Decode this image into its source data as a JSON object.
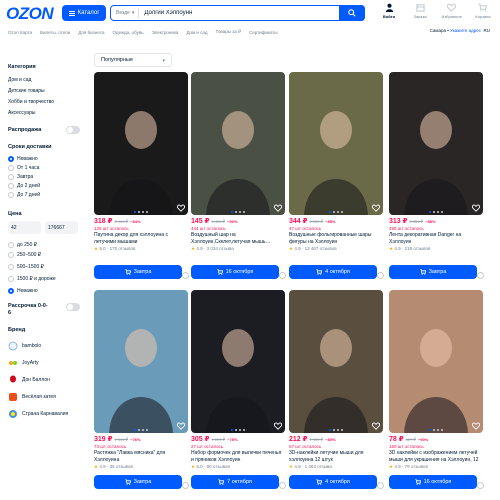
{
  "header": {
    "logo": "OZON",
    "catalog_label": "Каталог",
    "search_scope": "Везде",
    "search_query": "Долгий Хэппоунн",
    "icons": [
      {
        "name": "profile",
        "label": "Войти"
      },
      {
        "name": "orders",
        "label": "Заказы"
      },
      {
        "name": "favorites",
        "label": "Избранное"
      },
      {
        "name": "cart",
        "label": "Корзина"
      }
    ]
  },
  "subheader": {
    "links": [
      "Ozon Карта",
      "Билеты, отели",
      "Для бизнеса",
      "Одежда, обувь",
      "Электроника",
      "Дом и сад",
      "Товары за ₽",
      "Сертификаты"
    ],
    "location": "Самара",
    "address_link": "Укажите адрес",
    "lang": "RU"
  },
  "sort": {
    "label": "Популярные"
  },
  "sidebar": {
    "category_title": "Категория",
    "categories": [
      "Дом и сад",
      "Детские товары",
      "Хобби и творчество",
      "Аксессуары"
    ],
    "sale_label": "Распродажа",
    "delivery_title": "Сроки доставки",
    "delivery_options": [
      "Неважно",
      "От 1 часа",
      "Завтра",
      "До 2 дней",
      "До 7 дней"
    ],
    "price_title": "Цена",
    "price_from": "42",
    "price_to": "176667",
    "price_options": [
      "до 250 ₽",
      "250–500 ₽",
      "500–1500 ₽",
      "1500 ₽ и дороже",
      "Неважно"
    ],
    "installment_label": "Рассрочка 0-0-6",
    "brand_title": "Бренд",
    "brands": [
      "bambolo",
      "JoyArty",
      "Дон Баллон",
      "Весёлая затея",
      "Страна Карнавалия"
    ]
  },
  "products": [
    {
      "price": "318 ₽",
      "old_price": "2 009 ₽",
      "discount": "−84%",
      "left": "129 шт осталось",
      "title": "Паутина декор для хэллоуина с летучими мышами",
      "rating": "5.0",
      "reviews": "170 отзывов",
      "button": "Завтра"
    },
    {
      "price": "145 ₽",
      "old_price": "1 405 ₽",
      "discount": "−90%",
      "left": "444 шт осталось",
      "title": "Воздушный шар на Хэллоуин,Скелет,летучая мышь…",
      "rating": "4.9",
      "reviews": "3 034 отзыва",
      "button": "16 октября"
    },
    {
      "price": "344 ₽",
      "old_price": "2 250 ₽",
      "discount": "−85%",
      "left": "47 шт осталось",
      "title": "Воздушные фольгированные шары фигуры на Хэллоуин",
      "rating": "4.9",
      "reviews": "13 467 отзывов",
      "button": "4 октября"
    },
    {
      "price": "313 ₽",
      "old_price": "2 051 ₽",
      "discount": "−85%",
      "left": "495 шт осталось",
      "title": "Лента декоративная Danger на Хэллоуин",
      "rating": "4.9",
      "reviews": "216 отзывов",
      "button": "Завтра"
    },
    {
      "price": "319 ₽",
      "old_price": "1 341 ₽",
      "discount": "−76%",
      "left": "73 шт осталось",
      "title": "Растяжка \"Лавка мясника\" для Хэллоуина",
      "rating": "4.9",
      "reviews": "35 отзывов",
      "button": "Завтра"
    },
    {
      "price": "305 ₽",
      "old_price": "1 229 ₽",
      "discount": "−75%",
      "left": "27 шт осталось",
      "title": "Набор формочек для выпечки печенья и пряников Хэллоуин",
      "rating": "5.0",
      "reviews": "80 отзывов",
      "button": "7 октября"
    },
    {
      "price": "212 ₽",
      "old_price": "1 059 ₽",
      "discount": "−80%",
      "left": "57 шт осталось",
      "title": "3D-наклейки летучие мыши для хэллоуина 12 штук",
      "rating": "4.9",
      "reviews": "1 463 отзыва",
      "button": "4 октября"
    },
    {
      "price": "78 ₽",
      "old_price": "827 ₽",
      "discount": "−90%",
      "left": "150 шт осталось",
      "title": "3D наклейки с изображением летучей мыши для украшения на Хэллоуин, 12 шт.",
      "rating": "4.9",
      "reviews": "79 отзывов",
      "button": "16 октября"
    }
  ],
  "colors": {
    "brand_blue": "#005bff",
    "price_pink": "#f91155",
    "star": "#ffa800"
  }
}
